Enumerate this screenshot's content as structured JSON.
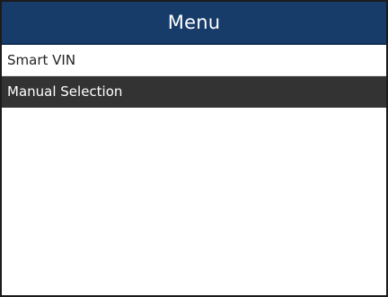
{
  "header": {
    "title": "Menu"
  },
  "menu": {
    "selected_index": 1,
    "items": [
      {
        "label": "Smart VIN"
      },
      {
        "label": "Manual Selection"
      }
    ]
  },
  "colors": {
    "header_bg": "#173c6a",
    "selected_bg": "#333333",
    "text": "#222222",
    "selected_text": "#ffffff"
  }
}
